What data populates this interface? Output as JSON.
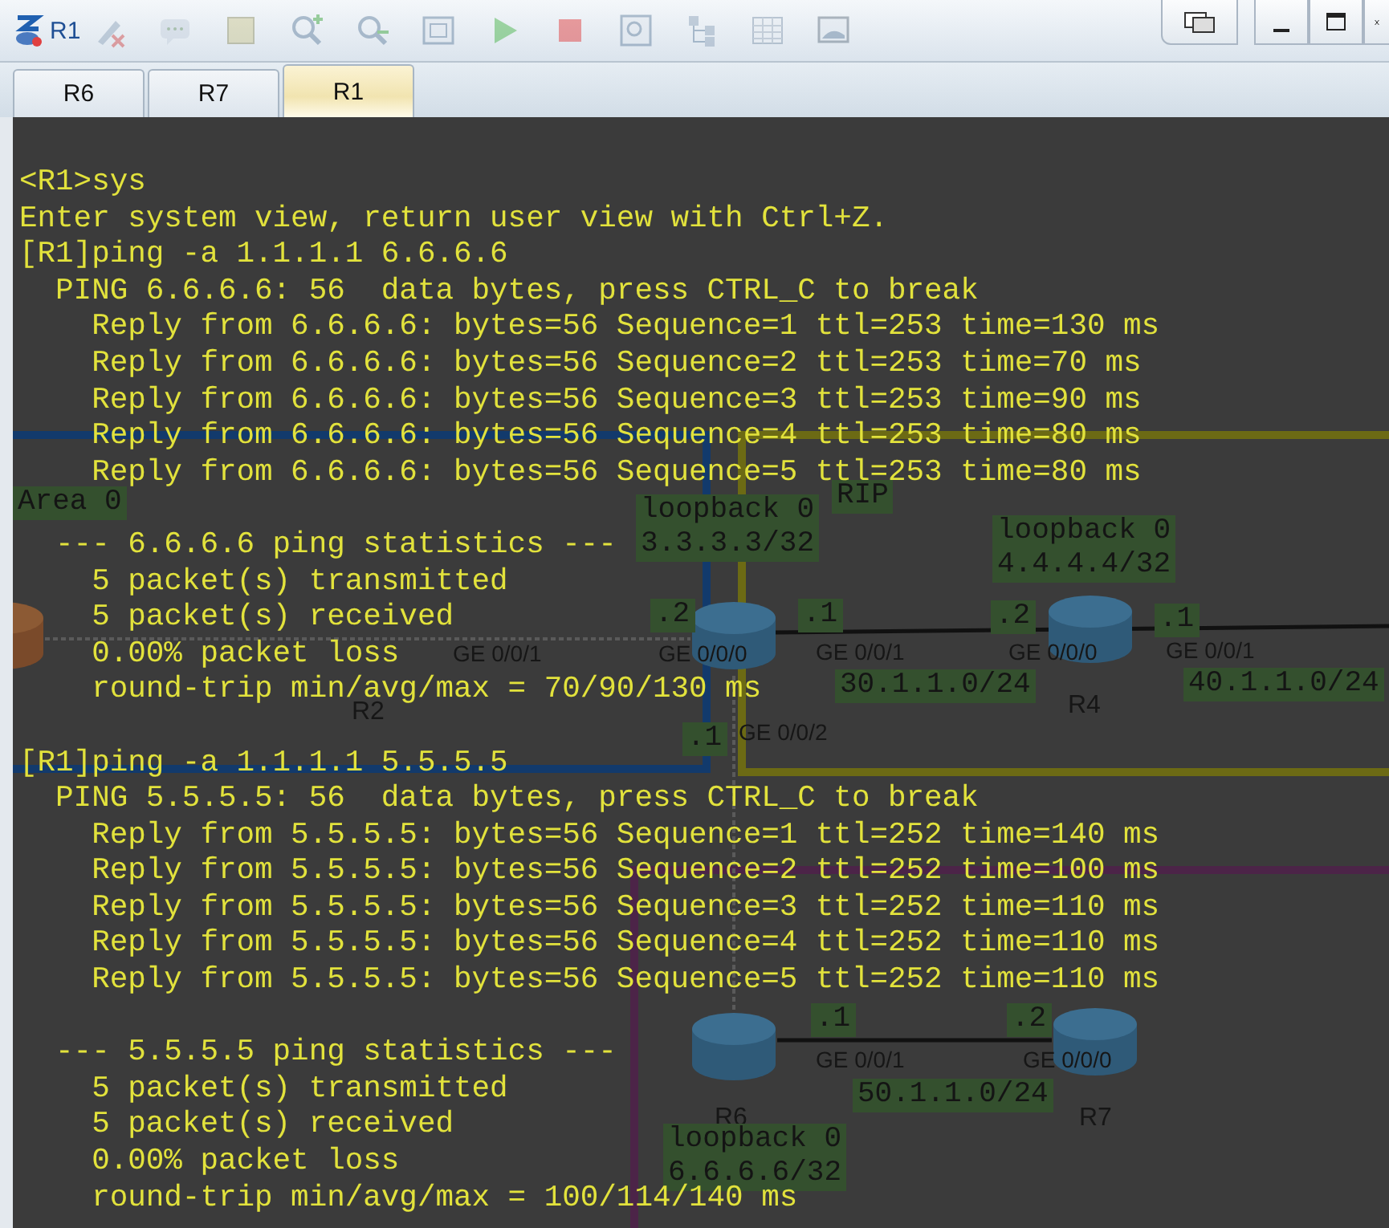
{
  "window": {
    "title": "R1"
  },
  "tabs": [
    {
      "label": "R6",
      "selected": false
    },
    {
      "label": "R7",
      "selected": false
    },
    {
      "label": "R1",
      "selected": true
    }
  ],
  "topology": {
    "labels": [
      {
        "kind": "tag",
        "lines": [
          "Area 0"
        ]
      },
      {
        "kind": "tag",
        "lines": [
          "loopback 0",
          "3.3.3.3/32"
        ]
      },
      {
        "kind": "tag",
        "lines": [
          "RIP"
        ]
      },
      {
        "kind": "tag",
        "lines": [
          "loopback 0",
          "4.4.4.4/32"
        ]
      },
      {
        "kind": "tag",
        "lines": [
          ".2"
        ]
      },
      {
        "kind": "tag",
        "lines": [
          ".1"
        ]
      },
      {
        "kind": "tag",
        "lines": [
          ".2"
        ]
      },
      {
        "kind": "tag",
        "lines": [
          ".1"
        ]
      },
      {
        "kind": "port",
        "lines": [
          "GE 0/0/1"
        ]
      },
      {
        "kind": "port",
        "lines": [
          "GE 0/0/0"
        ]
      },
      {
        "kind": "port",
        "lines": [
          "GE 0/0/1"
        ]
      },
      {
        "kind": "port",
        "lines": [
          "GE 0/0/0"
        ]
      },
      {
        "kind": "port",
        "lines": [
          "GE 0/0/1"
        ]
      },
      {
        "kind": "tag",
        "lines": [
          "30.1.1.0/24"
        ]
      },
      {
        "kind": "tag",
        "lines": [
          "40.1.1.0/24"
        ]
      },
      {
        "kind": "name",
        "lines": [
          "R2"
        ]
      },
      {
        "kind": "name",
        "lines": [
          "R4"
        ]
      },
      {
        "kind": "tag",
        "lines": [
          ".1"
        ]
      },
      {
        "kind": "port",
        "lines": [
          "GE 0/0/2"
        ]
      },
      {
        "kind": "tag",
        "lines": [
          ".1"
        ]
      },
      {
        "kind": "tag",
        "lines": [
          ".2"
        ]
      },
      {
        "kind": "port",
        "lines": [
          "GE 0/0/1"
        ]
      },
      {
        "kind": "port",
        "lines": [
          "GE 0/0/0"
        ]
      },
      {
        "kind": "tag",
        "lines": [
          "50.1.1.0/24"
        ]
      },
      {
        "kind": "name",
        "lines": [
          "R6"
        ]
      },
      {
        "kind": "name",
        "lines": [
          "R7"
        ]
      },
      {
        "kind": "tag",
        "lines": [
          "loopback 0",
          "6.6.6.6/32"
        ]
      }
    ]
  },
  "terminal": {
    "blocks": [
      [
        "<R1>sys",
        "Enter system view, return user view with Ctrl+Z.",
        "[R1]ping -a 1.1.1.1 6.6.6.6",
        "  PING 6.6.6.6: 56  data bytes, press CTRL_C to break",
        "    Reply from 6.6.6.6: bytes=56 Sequence=1 ttl=253 time=130 ms",
        "    Reply from 6.6.6.6: bytes=56 Sequence=2 ttl=253 time=70 ms",
        "    Reply from 6.6.6.6: bytes=56 Sequence=3 ttl=253 time=90 ms",
        "    Reply from 6.6.6.6: bytes=56 Sequence=4 ttl=253 time=80 ms",
        "    Reply from 6.6.6.6: bytes=56 Sequence=5 ttl=253 time=80 ms"
      ],
      [
        "  --- 6.6.6.6 ping statistics ---",
        "    5 packet(s) transmitted",
        "    5 packet(s) received",
        "    0.00% packet loss",
        "    round-trip min/avg/max = 70/90/130 ms"
      ],
      [
        "[R1]ping -a 1.1.1.1 5.5.5.5",
        "  PING 5.5.5.5: 56  data bytes, press CTRL_C to break",
        "    Reply from 5.5.5.5: bytes=56 Sequence=1 ttl=252 time=140 ms",
        "    Reply from 5.5.5.5: bytes=56 Sequence=2 ttl=252 time=100 ms",
        "    Reply from 5.5.5.5: bytes=56 Sequence=3 ttl=252 time=110 ms",
        "    Reply from 5.5.5.5: bytes=56 Sequence=4 ttl=252 time=110 ms",
        "    Reply from 5.5.5.5: bytes=56 Sequence=5 ttl=252 time=110 ms"
      ],
      [
        "  --- 5.5.5.5 ping statistics ---",
        "    5 packet(s) transmitted",
        "    5 packet(s) received",
        "    0.00% packet loss",
        "    round-trip min/avg/max = 100/114/140 ms"
      ]
    ]
  }
}
